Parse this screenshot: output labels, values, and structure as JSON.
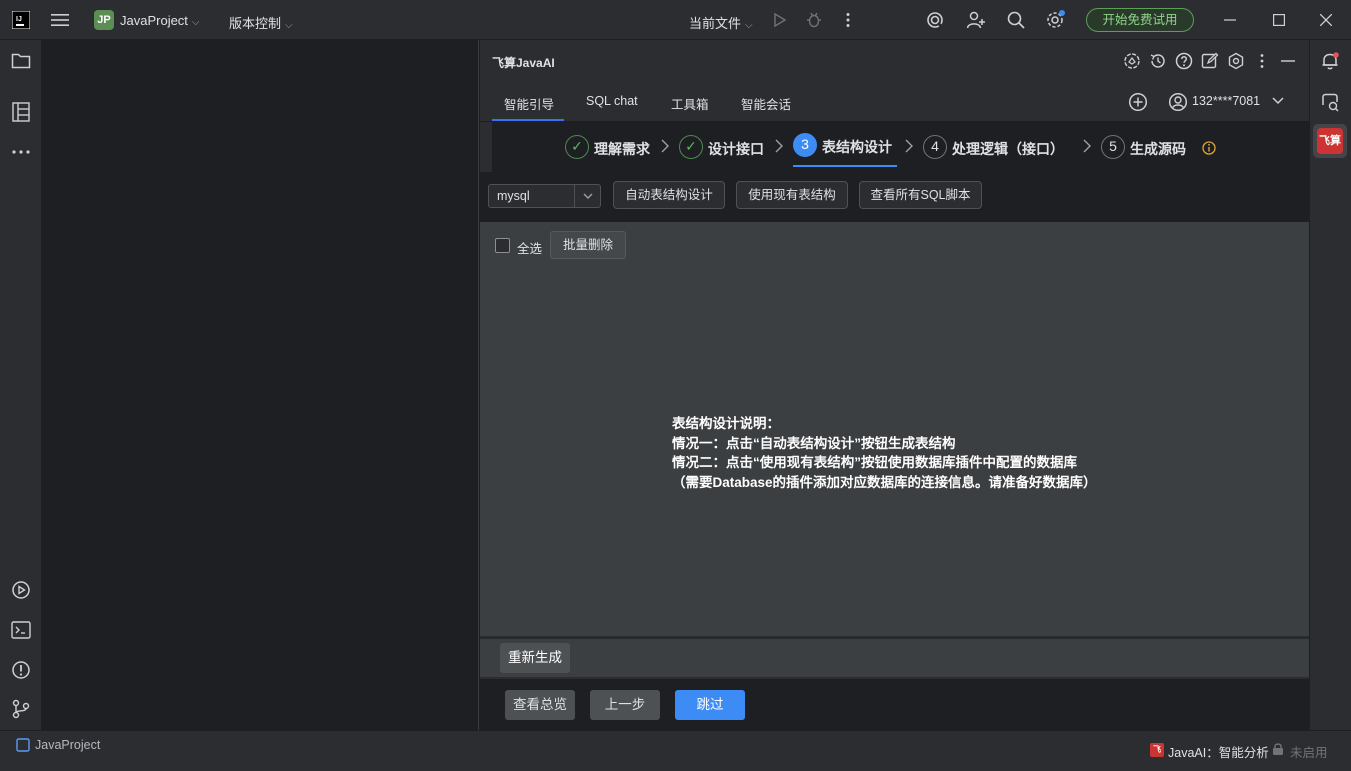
{
  "titlebar": {
    "project_initials": "JP",
    "project_name": "JavaProject",
    "vcs_label": "版本控制",
    "run_config": "当前文件",
    "trial_button": "开始免费试用"
  },
  "panel": {
    "title": "飞算JavaAI",
    "tabs": [
      "智能引导",
      "SQL chat",
      "工具箱",
      "智能会话"
    ],
    "active_tab": "智能引导",
    "account": "132****7081"
  },
  "steps": [
    {
      "marker": "✓",
      "label": "理解需求",
      "state": "done"
    },
    {
      "marker": "✓",
      "label": "设计接口",
      "state": "done"
    },
    {
      "marker": "3",
      "label": "表结构设计",
      "state": "active"
    },
    {
      "marker": "4",
      "label": "处理逻辑（接口）",
      "state": "todo"
    },
    {
      "marker": "5",
      "label": "生成源码",
      "state": "todo"
    }
  ],
  "toolbar": {
    "db_type": "mysql",
    "auto_design": "自动表结构设计",
    "use_existing": "使用现有表结构",
    "view_sql": "查看所有SQL脚本"
  },
  "list": {
    "select_all": "全选",
    "batch_delete": "批量删除"
  },
  "instructions": [
    "表结构设计说明：",
    "情况一：点击“自动表结构设计”按钮生成表结构",
    "情况二：点击“使用现有表结构”按钮使用数据库插件中配置的数据库",
    "（需要Database的插件添加对应数据库的连接信息。请准备好数据库）"
  ],
  "actions": {
    "regenerate": "重新生成",
    "overview": "查看总览",
    "previous": "上一步",
    "skip": "跳过"
  },
  "right_strip": {
    "plugin_badge": "飞算"
  },
  "statusbar": {
    "project": "JavaProject",
    "plugin_badge": "飞",
    "ai_status": "JavaAI：智能分析",
    "lock_status": "未启用"
  },
  "colors": {
    "accent": "#3d8cf5",
    "success": "#5fb85f",
    "trial": "#8fd68a",
    "brand_red": "#cc3333"
  }
}
